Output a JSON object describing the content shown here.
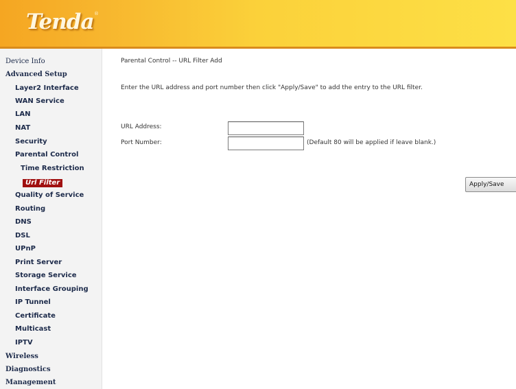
{
  "header": {
    "logo_text": "Tenda",
    "logo_mark": "®"
  },
  "sidebar": {
    "items": [
      {
        "label": "Device Info"
      },
      {
        "label": "Advanced Setup"
      },
      {
        "label": "Layer2 Interface"
      },
      {
        "label": "WAN Service"
      },
      {
        "label": "LAN"
      },
      {
        "label": "NAT"
      },
      {
        "label": "Security"
      },
      {
        "label": "Parental Control"
      },
      {
        "label": "Time Restriction"
      },
      {
        "label": "Url Filter"
      },
      {
        "label": "Quality of Service"
      },
      {
        "label": "Routing"
      },
      {
        "label": "DNS"
      },
      {
        "label": "DSL"
      },
      {
        "label": "UPnP"
      },
      {
        "label": "Print Server"
      },
      {
        "label": "Storage Service"
      },
      {
        "label": "Interface Grouping"
      },
      {
        "label": "IP Tunnel"
      },
      {
        "label": "Certificate"
      },
      {
        "label": "Multicast"
      },
      {
        "label": "IPTV"
      },
      {
        "label": "Wireless"
      },
      {
        "label": "Diagnostics"
      },
      {
        "label": "Management"
      }
    ],
    "selected_label": "Url Filter",
    "selected_color": "#a01010"
  },
  "main": {
    "title": "Parental Control -- URL Filter Add",
    "instructions": "Enter the URL address and port number then click \"Apply/Save\" to add the entry to the URL filter.",
    "url_label": "URL Address:",
    "url_value": "",
    "port_label": "Port Number:",
    "port_value": "",
    "port_hint": "(Default 80 will be applied if leave blank.)",
    "apply_label": "Apply/Save"
  }
}
